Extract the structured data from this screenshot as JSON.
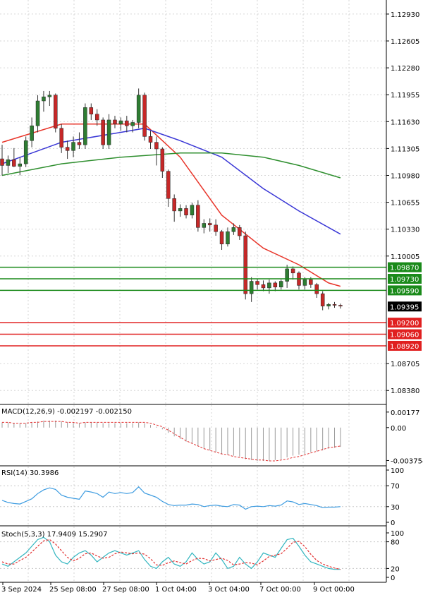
{
  "chart_data": [
    {
      "type": "candlestick",
      "title": "",
      "x_labels": [
        "3 Sep 2024",
        "25 Sep 08:00",
        "27 Sep 08:00",
        "1 Oct 04:00",
        "3 Oct 04:00",
        "7 Oct 00:00",
        "9 Oct 00:00"
      ],
      "y_ticks": [
        "1.12930",
        "1.12605",
        "1.12280",
        "1.11955",
        "1.11630",
        "1.11305",
        "1.10980",
        "1.10655",
        "1.10330",
        "1.10005",
        "1.08705",
        "1.08380"
      ],
      "ylim": [
        1.0822,
        1.131
      ],
      "grid": true,
      "colors": {
        "up": "#2e7d32",
        "down": "#c62828",
        "wick": "#333333"
      },
      "candles": [
        [
          1.1118,
          1.1135,
          1.1098,
          1.111
        ],
        [
          1.111,
          1.1122,
          1.1101,
          1.1117
        ],
        [
          1.1117,
          1.1131,
          1.1108,
          1.1109
        ],
        [
          1.1109,
          1.112,
          1.1098,
          1.1112
        ],
        [
          1.1112,
          1.1145,
          1.1108,
          1.114
        ],
        [
          1.114,
          1.1168,
          1.1132,
          1.1158
        ],
        [
          1.1158,
          1.1195,
          1.115,
          1.1188
        ],
        [
          1.1188,
          1.12,
          1.1175,
          1.1193
        ],
        [
          1.1193,
          1.12,
          1.1182,
          1.1195
        ],
        [
          1.1195,
          1.1197,
          1.115,
          1.1155
        ],
        [
          1.1155,
          1.116,
          1.1125,
          1.1132
        ],
        [
          1.1132,
          1.114,
          1.1118,
          1.1128
        ],
        [
          1.1128,
          1.1145,
          1.112,
          1.1138
        ],
        [
          1.1138,
          1.115,
          1.113,
          1.1135
        ],
        [
          1.1135,
          1.1185,
          1.113,
          1.118
        ],
        [
          1.118,
          1.1185,
          1.1165,
          1.1172
        ],
        [
          1.1172,
          1.1178,
          1.1158,
          1.1165
        ],
        [
          1.1165,
          1.1168,
          1.113,
          1.1135
        ],
        [
          1.1135,
          1.1172,
          1.113,
          1.1165
        ],
        [
          1.1165,
          1.117,
          1.1155,
          1.116
        ],
        [
          1.116,
          1.1168,
          1.1152,
          1.1164
        ],
        [
          1.1164,
          1.117,
          1.115,
          1.1158
        ],
        [
          1.1158,
          1.1165,
          1.115,
          1.1162
        ],
        [
          1.1162,
          1.1203,
          1.1155,
          1.1195
        ],
        [
          1.1195,
          1.1198,
          1.114,
          1.1145
        ],
        [
          1.1145,
          1.1152,
          1.113,
          1.1138
        ],
        [
          1.1138,
          1.1145,
          1.111,
          1.113
        ],
        [
          1.113,
          1.1132,
          1.1095,
          1.1103
        ],
        [
          1.1103,
          1.1105,
          1.106,
          1.107
        ],
        [
          1.107,
          1.1075,
          1.1042,
          1.1055
        ],
        [
          1.1055,
          1.1063,
          1.1048,
          1.1058
        ],
        [
          1.1058,
          1.1062,
          1.1046,
          1.105
        ],
        [
          1.105,
          1.1065,
          1.1046,
          1.1062
        ],
        [
          1.1062,
          1.1068,
          1.103,
          1.1035
        ],
        [
          1.1035,
          1.1045,
          1.1028,
          1.104
        ],
        [
          1.104,
          1.1046,
          1.103,
          1.1038
        ],
        [
          1.1038,
          1.1045,
          1.1025,
          1.103
        ],
        [
          1.103,
          1.1032,
          1.1008,
          1.1015
        ],
        [
          1.1015,
          1.1035,
          1.1012,
          1.103
        ],
        [
          1.103,
          1.104,
          1.1026,
          1.1035
        ],
        [
          1.1035,
          1.1038,
          1.102,
          1.1025
        ],
        [
          1.1025,
          1.103,
          1.0948,
          1.0955
        ],
        [
          1.0955,
          1.0975,
          1.0945,
          1.097
        ],
        [
          1.097,
          1.0973,
          1.096,
          1.0966
        ],
        [
          1.0966,
          1.0971,
          1.0958,
          1.0962
        ],
        [
          1.0962,
          1.0972,
          1.0955,
          1.0968
        ],
        [
          1.0968,
          1.097,
          1.0958,
          1.0963
        ],
        [
          1.0963,
          1.0972,
          1.096,
          1.097
        ],
        [
          1.097,
          1.099,
          1.0962,
          1.0985
        ],
        [
          1.0985,
          1.0988,
          1.0972,
          1.098
        ],
        [
          1.098,
          1.0982,
          1.096,
          1.0965
        ],
        [
          1.0965,
          1.0975,
          1.096,
          1.0972
        ],
        [
          1.0972,
          1.0975,
          1.0962,
          1.0966
        ],
        [
          1.0966,
          1.0968,
          1.095,
          1.0955
        ],
        [
          1.0955,
          1.0958,
          1.0935,
          1.094
        ],
        [
          1.094,
          1.0944,
          1.0936,
          1.0942
        ],
        [
          1.0942,
          1.0945,
          1.0938,
          1.0941
        ],
        [
          1.0941,
          1.0943,
          1.0937,
          1.094
        ]
      ],
      "series": [
        {
          "name": "",
          "color": "#e8352a",
          "points": [
            [
              0,
              1.1138
            ],
            [
              10,
              1.116
            ],
            [
              20,
              1.116
            ],
            [
              24,
              1.116
            ],
            [
              30,
              1.112
            ],
            [
              37,
              1.105
            ],
            [
              44,
              1.101
            ],
            [
              50,
              1.099
            ],
            [
              55,
              1.0968
            ],
            [
              57,
              1.0964
            ]
          ]
        },
        {
          "name": "",
          "color": "#3a37d6",
          "points": [
            [
              0,
              1.1112
            ],
            [
              10,
              1.1138
            ],
            [
              20,
              1.115
            ],
            [
              24,
              1.1155
            ],
            [
              30,
              1.114
            ],
            [
              37,
              1.112
            ],
            [
              44,
              1.1082
            ],
            [
              50,
              1.1055
            ],
            [
              57,
              1.1027
            ]
          ]
        },
        {
          "name": "",
          "color": "#2f8f2f",
          "points": [
            [
              0,
              1.1098
            ],
            [
              10,
              1.1112
            ],
            [
              20,
              1.112
            ],
            [
              30,
              1.1125
            ],
            [
              37,
              1.1125
            ],
            [
              44,
              1.112
            ],
            [
              50,
              1.111
            ],
            [
              57,
              1.1095
            ]
          ]
        }
      ],
      "levels": [
        {
          "value": 1.0987,
          "label": "1.09870",
          "color": "#1a8a1a"
        },
        {
          "value": 1.0973,
          "label": "1.09730",
          "color": "#1a8a1a"
        },
        {
          "value": 1.0959,
          "label": "1.09590",
          "color": "#1a8a1a"
        },
        {
          "value": 1.092,
          "label": "1.09200",
          "color": "#e02020"
        },
        {
          "value": 1.0906,
          "label": "1.09060",
          "color": "#e02020"
        },
        {
          "value": 1.0892,
          "label": "1.08920",
          "color": "#e02020"
        }
      ],
      "current_price": {
        "value": 1.09395,
        "label": "1.09395"
      }
    },
    {
      "type": "macd",
      "title": "MACD(12,26,9) -0.002197 -0.002150",
      "y_ticks": [
        "0.00177",
        "0.00",
        "-0.003754"
      ],
      "ylim": [
        -0.0042,
        0.0024
      ],
      "histogram": [
        0.0006,
        0.0006,
        0.0005,
        0.0005,
        0.0005,
        0.0006,
        0.0007,
        0.0008,
        0.0008,
        0.0008,
        0.0007,
        0.0006,
        0.0005,
        0.0005,
        0.0006,
        0.0006,
        0.0006,
        0.0005,
        0.0005,
        0.0005,
        0.0005,
        0.0005,
        0.0005,
        0.0006,
        0.0005,
        0.0003,
        0.0001,
        -0.0002,
        -0.0006,
        -0.001,
        -0.0013,
        -0.0016,
        -0.0018,
        -0.0021,
        -0.0024,
        -0.0026,
        -0.0028,
        -0.003,
        -0.0031,
        -0.0032,
        -0.0033,
        -0.0036,
        -0.0037,
        -0.0038,
        -0.0038,
        -0.0038,
        -0.0037,
        -0.0036,
        -0.0034,
        -0.0032,
        -0.0031,
        -0.003,
        -0.0028,
        -0.0027,
        -0.0026,
        -0.0024,
        -0.0023,
        -0.0022
      ],
      "signal": [
        0.0006,
        0.0006,
        0.0005,
        0.0005,
        0.0005,
        0.0006,
        0.0006,
        0.0007,
        0.0007,
        0.0007,
        0.0007,
        0.0006,
        0.0006,
        0.0005,
        0.0006,
        0.0006,
        0.0006,
        0.0006,
        0.0006,
        0.0006,
        0.0006,
        0.0006,
        0.0006,
        0.0006,
        0.0006,
        0.0005,
        0.0003,
        0.0001,
        -0.0003,
        -0.0007,
        -0.0011,
        -0.0015,
        -0.0018,
        -0.0021,
        -0.0024,
        -0.0026,
        -0.0028,
        -0.003,
        -0.0031,
        -0.0033,
        -0.0034,
        -0.0035,
        -0.0036,
        -0.0037,
        -0.0037,
        -0.0038,
        -0.0038,
        -0.0037,
        -0.0036,
        -0.0034,
        -0.0033,
        -0.0031,
        -0.0029,
        -0.0027,
        -0.0025,
        -0.0023,
        -0.0022,
        -0.0021
      ]
    },
    {
      "type": "line",
      "title": "RSI(14) 30.3986",
      "y_ticks": [
        "100",
        "70",
        "30",
        "0"
      ],
      "ylim": [
        0,
        100
      ],
      "series": [
        {
          "name": "",
          "color": "#3c9be0",
          "values": [
            42,
            38,
            36,
            35,
            40,
            45,
            55,
            62,
            66,
            63,
            52,
            48,
            46,
            44,
            60,
            58,
            55,
            48,
            58,
            55,
            57,
            55,
            57,
            68,
            56,
            52,
            48,
            40,
            34,
            32,
            33,
            33,
            35,
            34,
            30,
            32,
            33,
            31,
            30,
            34,
            33,
            25,
            30,
            31,
            30,
            32,
            31,
            33,
            41,
            39,
            34,
            36,
            34,
            32,
            28,
            29,
            29,
            30
          ]
        }
      ]
    },
    {
      "type": "line",
      "title": "Stoch(5,3,3) 17.9409 15.2907",
      "y_ticks": [
        "100",
        "80",
        "20",
        "0"
      ],
      "ylim": [
        0,
        100
      ],
      "series": [
        {
          "name": "",
          "color": "#33b6c0",
          "values": [
            30,
            25,
            35,
            45,
            55,
            70,
            85,
            90,
            80,
            50,
            35,
            30,
            45,
            55,
            60,
            50,
            35,
            45,
            55,
            60,
            55,
            50,
            55,
            60,
            40,
            25,
            20,
            35,
            45,
            30,
            25,
            35,
            55,
            40,
            30,
            35,
            55,
            40,
            20,
            25,
            45,
            30,
            20,
            35,
            55,
            50,
            45,
            65,
            85,
            88,
            70,
            50,
            35,
            30,
            25,
            20,
            18,
            18
          ]
        },
        {
          "name": "",
          "color": "#e23030",
          "values": [
            35,
            30,
            30,
            38,
            45,
            57,
            70,
            82,
            85,
            75,
            60,
            45,
            37,
            43,
            53,
            55,
            48,
            43,
            45,
            53,
            57,
            55,
            53,
            55,
            52,
            42,
            28,
            27,
            33,
            37,
            33,
            30,
            38,
            43,
            42,
            37,
            40,
            43,
            38,
            28,
            30,
            33,
            32,
            28,
            37,
            47,
            50,
            53,
            65,
            79,
            81,
            69,
            52,
            38,
            30,
            25,
            21,
            18
          ]
        }
      ]
    }
  ]
}
